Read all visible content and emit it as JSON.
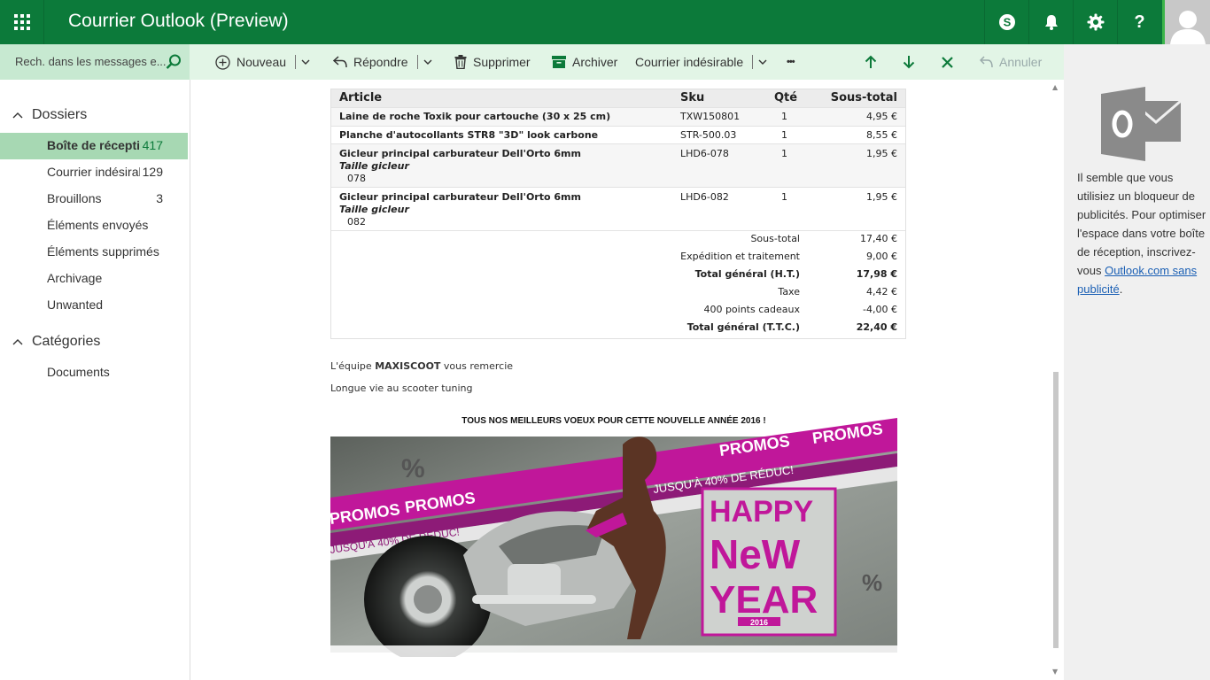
{
  "app": {
    "title": "Courrier Outlook (Preview)"
  },
  "colors": {
    "brand": "#0c7a3a",
    "cmdbar_bg": "#e2f5e6",
    "search_bg": "#c7e9d1",
    "selected_bg": "#a7d8b3",
    "avatar_bar": "#3cb54a"
  },
  "topbar": {
    "icons": [
      "skype-icon",
      "bell-icon",
      "gear-icon",
      "help-icon"
    ],
    "help_glyph": "?"
  },
  "search": {
    "placeholder": "Rech. dans les messages e..."
  },
  "toolbar": {
    "new_label": "Nouveau",
    "reply_label": "Répondre",
    "delete_label": "Supprimer",
    "archive_label": "Archiver",
    "junk_label": "Courrier indésirable",
    "more_label": "•••",
    "undo_label": "Annuler"
  },
  "nav": {
    "folders_header": "Dossiers",
    "folders": [
      {
        "label": "Boîte de réception",
        "count": "417"
      },
      {
        "label": "Courrier indésirable",
        "count": "129"
      },
      {
        "label": "Brouillons",
        "count": "3"
      },
      {
        "label": "Éléments envoyés",
        "count": ""
      },
      {
        "label": "Éléments supprimés",
        "count": ""
      },
      {
        "label": "Archivage",
        "count": ""
      },
      {
        "label": "Unwanted",
        "count": ""
      }
    ],
    "categories_header": "Catégories",
    "categories": [
      {
        "label": "Documents"
      }
    ]
  },
  "order": {
    "headers": {
      "article": "Article",
      "sku": "Sku",
      "qte": "Qté",
      "subtotal": "Sous-total"
    },
    "rows": [
      {
        "name": "Laine de roche Toxik pour cartouche (30 x 25 cm)",
        "sku": "TXW150801",
        "qte": "1",
        "subtotal": "4,95 €",
        "opt_label": "",
        "opt_value": ""
      },
      {
        "name": "Planche d'autocollants STR8 \"3D\" look carbone",
        "sku": "STR-500.03",
        "qte": "1",
        "subtotal": "8,55 €",
        "opt_label": "",
        "opt_value": ""
      },
      {
        "name": "Gicleur principal carburateur Dell'Orto 6mm",
        "sku": "LHD6-078",
        "qte": "1",
        "subtotal": "1,95 €",
        "opt_label": "Taille gicleur",
        "opt_value": "078"
      },
      {
        "name": "Gicleur principal carburateur Dell'Orto 6mm",
        "sku": "LHD6-082",
        "qte": "1",
        "subtotal": "1,95 €",
        "opt_label": "Taille gicleur",
        "opt_value": "082"
      }
    ],
    "totals": [
      {
        "label": "Sous-total",
        "value": "17,40 €",
        "bold": false
      },
      {
        "label": "Expédition et traitement",
        "value": "9,00 €",
        "bold": false
      },
      {
        "label": "Total général (H.T.)",
        "value": "17,98 €",
        "bold": true
      },
      {
        "label": "Taxe",
        "value": "4,42 €",
        "bold": false
      },
      {
        "label": "400 points cadeaux",
        "value": "-4,00 €",
        "bold": false
      },
      {
        "label": "Total général (T.T.C.)",
        "value": "22,40 €",
        "bold": true
      }
    ]
  },
  "message": {
    "thanks_prefix": "L'équipe ",
    "thanks_brand": "MAXISCOOT",
    "thanks_suffix": " vous remercie",
    "tagline": "Longue vie au scooter tuning"
  },
  "banner": {
    "title": "TOUS NOS MEILLEURS VOEUX POUR CETTE NOUVELLE ANNÉE 2016 !",
    "promo_word": "PROMOS",
    "discount_text": "JUSQU'À 40% DE RÉDUC!",
    "happy": "HAPPY",
    "new": "NeW",
    "year": "YEAR",
    "year_num": "2016"
  },
  "ad": {
    "text": "Il semble que vous utilisiez un bloqueur de publicités. Pour optimiser l'espace dans votre boîte de réception, inscrivez-vous ",
    "link": "Outlook.com sans publicité",
    "end": "."
  }
}
